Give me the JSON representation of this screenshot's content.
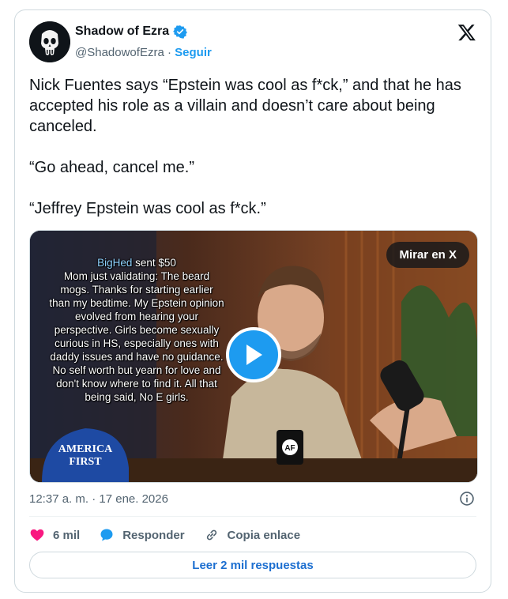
{
  "author": {
    "name": "Shadow of Ezra",
    "handle": "@ShadowofEzra",
    "separator": "·",
    "follow_label": "Seguir",
    "verified": true
  },
  "post": {
    "paragraphs": [
      "Nick Fuentes says “Epstein was cool as f*ck,” and that he has accepted his role as a villain and doesn’t care about being canceled.",
      "“Go ahead, cancel me.”",
      "“Jeffrey Epstein was cool as f*ck.”"
    ],
    "timestamp": "12:37 a. m. · 17 ene. 2026"
  },
  "media": {
    "watch_label": "Mirar en X",
    "overlay_user": "BigHed",
    "overlay_amount": " sent $50",
    "overlay_text": "Mom just validating: The beard mogs. Thanks for starting earlier than my bedtime. My Epstein opinion evolved from hearing your perspective. Girls become sexually curious in HS, especially ones with daddy issues and have no guidance. No self worth but yearn for love and don't know where to find it. All that being said, No E girls.",
    "hat_text_1": "AMERICA",
    "hat_text_2": "FIRST",
    "mug_text": "AF"
  },
  "actions": {
    "likes": "6 mil",
    "reply": "Responder",
    "copy_link": "Copia enlace",
    "read_replies": "Leer 2 mil respuestas"
  },
  "colors": {
    "accent": "#1d9bf0",
    "like": "#f91880",
    "muted": "#536471"
  },
  "icons": [
    "punisher-avatar-icon",
    "verified-badge-icon",
    "x-logo-icon",
    "play-icon",
    "info-icon",
    "heart-icon",
    "reply-bubble-icon",
    "link-icon"
  ]
}
